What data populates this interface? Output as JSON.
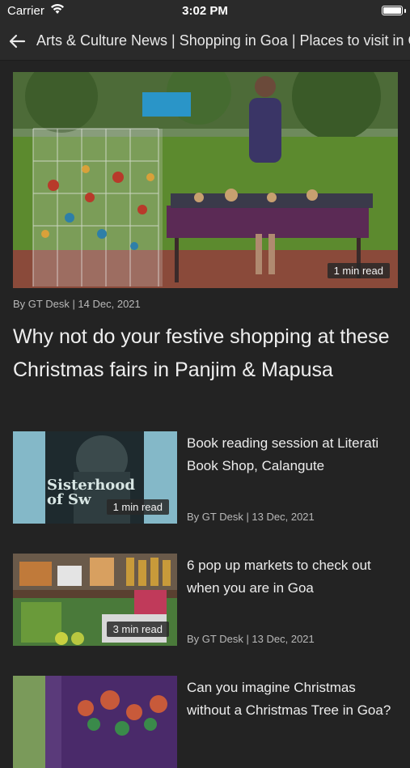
{
  "status": {
    "carrier": "Carrier",
    "time": "3:02 PM"
  },
  "nav": {
    "title": "Arts & Culture News | Shopping in Goa | Places to visit in Goa"
  },
  "hero": {
    "read_time": "1 min read",
    "byline": "By GT Desk | 14 Dec, 2021",
    "headline": "Why not do your festive shopping at these Christmas fairs in Panjim & Mapusa"
  },
  "articles": [
    {
      "title": "Book reading session at Literati Book Shop, Calangute",
      "byline": "By GT Desk | 13 Dec, 2021",
      "read_time": "1 min read",
      "cover_text": "Sisterhood of Sw"
    },
    {
      "title": "6 pop up markets to check out when you are in Goa",
      "byline": "By GT Desk | 13 Dec, 2021",
      "read_time": "3 min read"
    },
    {
      "title": "Can you imagine Christmas without a Christmas Tree in Goa?"
    }
  ]
}
